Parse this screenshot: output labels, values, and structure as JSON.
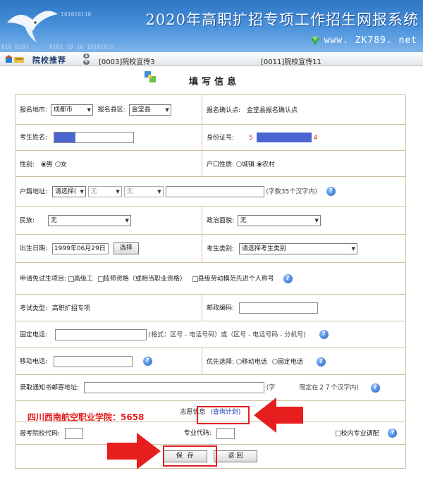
{
  "banner": {
    "title": "2020年高职扩招专项工作招生网报系统",
    "site": "www. ZK789. net",
    "binary1": "101010110",
    "binary2": "0101  10 10 10101010",
    "binary3": "010  0101"
  },
  "nav": {
    "title": "院校推荐",
    "announcements": [
      "[0003]院校宣传3",
      "[0011]院校宣传11"
    ]
  },
  "form": {
    "title": "填写信息",
    "fields": {
      "report_area_label": "报名地市:",
      "report_area_value": "成都市",
      "report_county_label": "报名县区:",
      "report_county_value": "金堂县",
      "confirm_point_label": "报名确认点:",
      "confirm_point_value": "金堂县报名确认点",
      "name_label": "考生姓名:",
      "id_label": "身份证号:",
      "id_prefix": "5",
      "id_suffix": "4",
      "gender_label": "性别:",
      "gender_male": "男",
      "gender_female": "女",
      "gender_selected": "男",
      "hukou_label": "户口性质:",
      "hukou_town": "城镇",
      "hukou_rural": "农村",
      "hukou_selected": "农村",
      "addr_label": "户籍地址:",
      "addr_select1": "请选择(",
      "addr_select2": "无",
      "addr_select3": "无",
      "addr_note": "(字数35个汉字内)",
      "nation_label": "民族:",
      "nation_value": "无",
      "politics_label": "政治面貌:",
      "politics_value": "无",
      "birth_label": "出生日期:",
      "birth_value": "1999年06月29日",
      "birth_button": "选择",
      "category_label": "考生类别:",
      "category_value": "请选择考生类别",
      "exempt_label": "申请免试生项目:",
      "exempt_opt1": "高级工",
      "exempt_opt2": "技师资格（或相当职业资格）",
      "exempt_opt3": "县级劳动模范先进个人称号",
      "exam_type_label": "考试类型:",
      "exam_type_value": "高职扩招专项",
      "postcode_label": "邮政编码:",
      "phone_label": "固定电话:",
      "phone_note": "(格式：区号 - 电话号码）或（区号 - 电话号码 - 分机号)",
      "mobile_label": "移动电话:",
      "priority_label": "优先选择:",
      "priority_mobile": "移动电话",
      "priority_fixed": "固定电话",
      "mail_label": "录取通知书邮寄地址:",
      "mail_note_prefix": "(字",
      "mail_note": "限定在２７个汉字内)",
      "wish_label": "志愿信息",
      "wish_link": "(查询计划)",
      "school_code_label": "报考院校代码:",
      "major_code_label": "专业代码:",
      "adjust_label": "校内专业调配"
    },
    "buttons": {
      "save": "保  存",
      "back": "返 回"
    }
  },
  "overlay": {
    "school_text": "四川西南航空职业学院：5658"
  },
  "colors": {
    "banner_blue": "#2e75c4",
    "highlight_red": "#e02020",
    "redaction_blue": "#4a64d2",
    "table_border": "#cfc2a6"
  }
}
